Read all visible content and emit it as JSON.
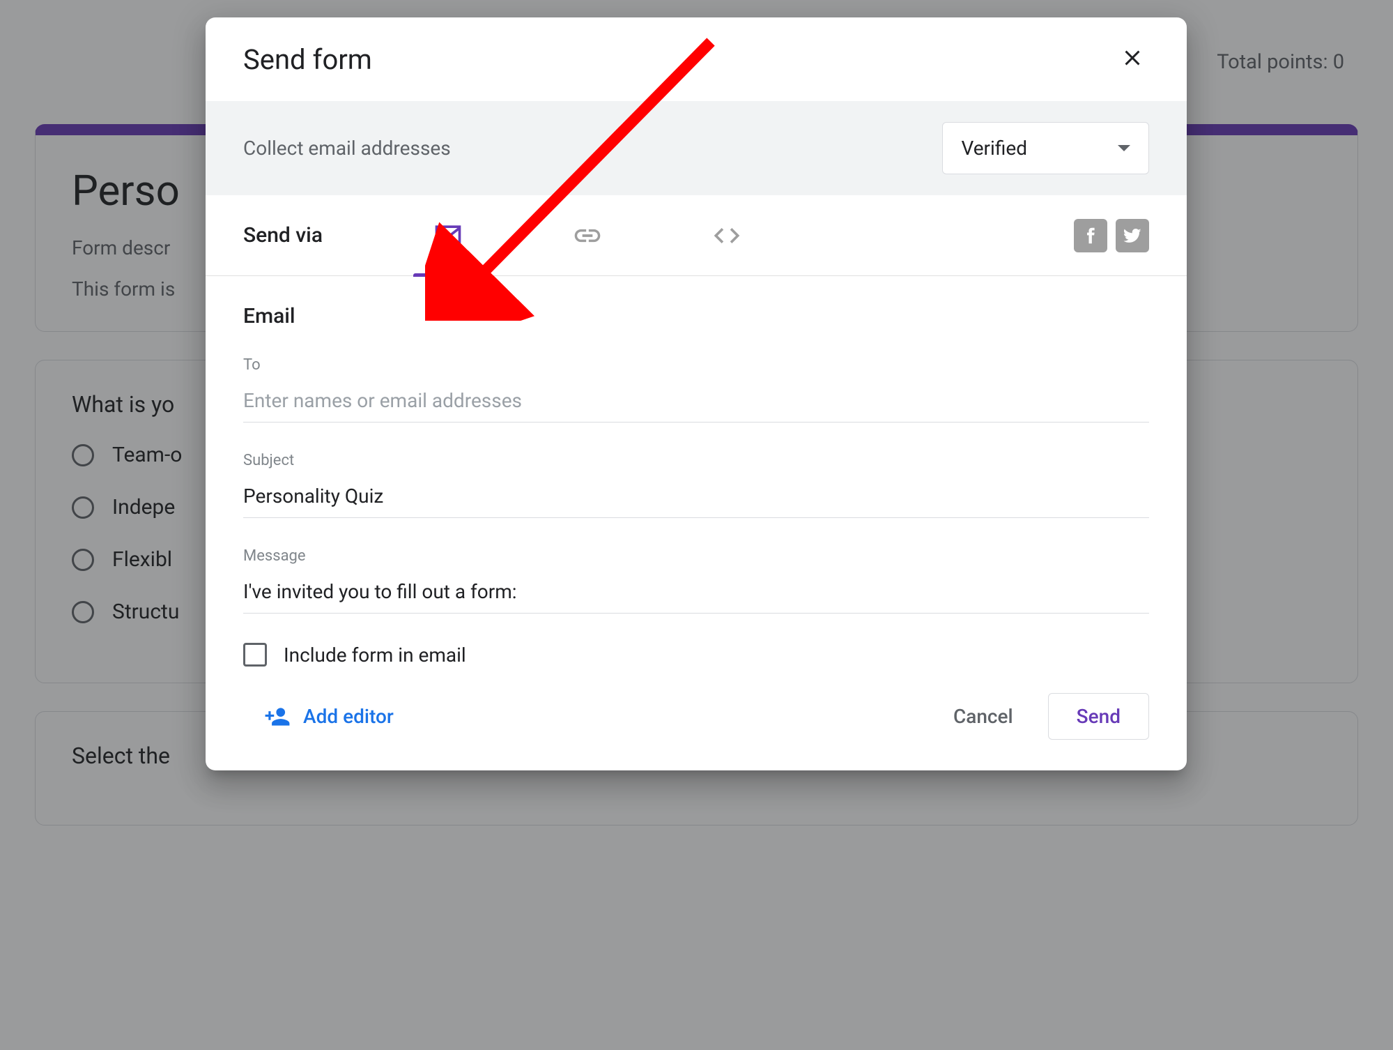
{
  "background": {
    "total_points": "Total points: 0",
    "title_partial": "Perso",
    "desc_partial": "Form descr",
    "meta_partial": "This form is",
    "q1": "What is yo",
    "opts": [
      "Team-o",
      "Indepe",
      "Flexibl",
      "Structu"
    ],
    "q2_partial": "Select the"
  },
  "modal": {
    "title": "Send form",
    "collect_label": "Collect email addresses",
    "collect_value": "Verified",
    "via_label": "Send via",
    "email_section": "Email",
    "to_label": "To",
    "to_placeholder": "Enter names or email addresses",
    "subject_label": "Subject",
    "subject_value": "Personality Quiz",
    "message_label": "Message",
    "message_value": "I've invited you to fill out a form:",
    "include_label": "Include form in email",
    "add_editor": "Add editor",
    "cancel": "Cancel",
    "send": "Send"
  }
}
